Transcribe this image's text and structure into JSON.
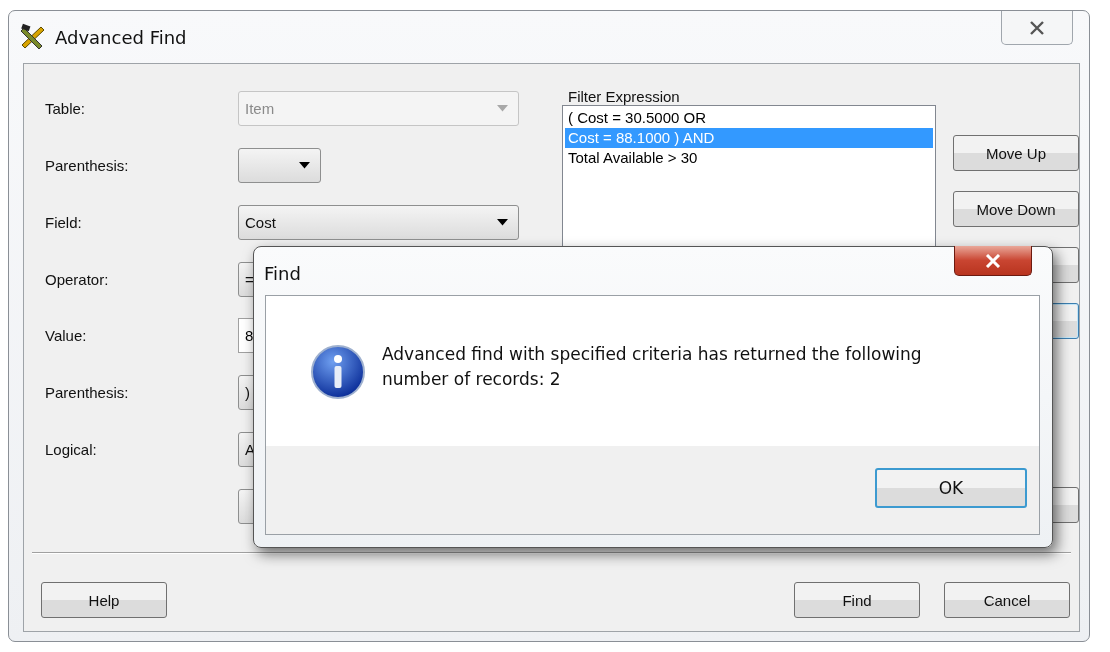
{
  "window": {
    "title": "Advanced Find"
  },
  "form": {
    "fields": [
      {
        "label": "Table:",
        "kind": "combo",
        "value": "Item",
        "disabled": true
      },
      {
        "label": "Parenthesis:",
        "kind": "short-combo",
        "disabled": false
      },
      {
        "label": "Field:",
        "kind": "combo",
        "value": "Cost",
        "disabled": false
      },
      {
        "label": "Operator:",
        "kind": "combo",
        "value": "=",
        "disabled": false
      },
      {
        "label": "Value:",
        "kind": "text",
        "value": "8",
        "disabled": false
      },
      {
        "label": "Parenthesis:",
        "kind": "short-combo",
        "value": ")",
        "disabled": false
      },
      {
        "label": "Logical:",
        "kind": "short-combo",
        "value": "A",
        "disabled": false
      }
    ]
  },
  "filter": {
    "label": "Filter Expression",
    "items": [
      {
        "text": "( Cost = 30.5000 OR",
        "selected": false
      },
      {
        "text": "Cost = 88.1000 ) AND",
        "selected": true
      },
      {
        "text": "Total Available > 30",
        "selected": false
      }
    ]
  },
  "side_buttons": [
    "Move Up",
    "Move Down"
  ],
  "footer_buttons": {
    "left": [
      "Help"
    ],
    "right": [
      "Find",
      "Cancel"
    ]
  },
  "dialog": {
    "title": "Find",
    "message_lines": [
      "Advanced find with specified criteria has returned the following",
      "number of records:  2"
    ],
    "button": "OK"
  }
}
